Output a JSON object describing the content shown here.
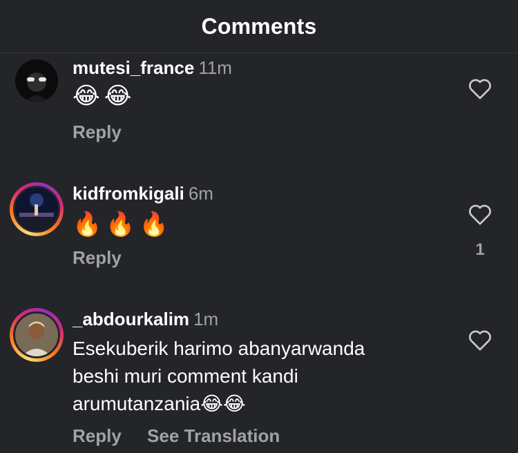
{
  "header": {
    "title": "Comments"
  },
  "comments": [
    {
      "username": "mutesi_france",
      "time": "11m",
      "text": "😂😂",
      "reply": "Reply",
      "like_count": ""
    },
    {
      "username": "kidfromkigali",
      "time": "6m",
      "text": "🔥🔥🔥",
      "reply": "Reply",
      "like_count": "1"
    },
    {
      "username": "_abdourkalim",
      "time": "1m",
      "text_lines": [
        "Esekuberik harimo abanyarwanda",
        "beshi muri comment kandi",
        "arumutanzania😂😂"
      ],
      "reply": "Reply",
      "see_translation": "See Translation",
      "like_count": ""
    }
  ],
  "icons": {
    "like": "heart-outline-icon"
  },
  "colors": {
    "background": "#242528",
    "secondary_text": "#a0a2a8"
  }
}
